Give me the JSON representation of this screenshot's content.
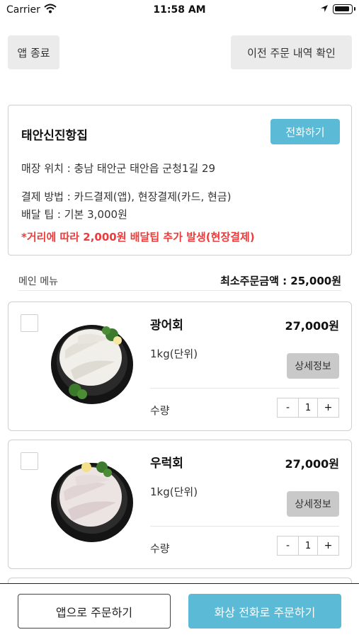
{
  "status_bar": {
    "carrier": "Carrier",
    "time": "11:58 AM",
    "icons": [
      "wifi-icon",
      "location-icon",
      "battery-icon"
    ]
  },
  "top_buttons": {
    "exit_label": "앱 종료",
    "history_label": "이전 주문 내역 확인"
  },
  "store": {
    "name": "태안신진항집",
    "call_label": "전화하기",
    "location": "매장 위치 : 충남 태안군 태안읍 군청1길 29",
    "payment": "결제 방법 : 카드결제(앱), 현장결제(카드, 현금)",
    "delivery_tip": "배달 팁 : 기본 3,000원",
    "notice": "*거리에 따라 2,000원 배달팁 추가 발생(현장결제)"
  },
  "section": {
    "title": "메인 메뉴",
    "min_order": "최소주문금액 : 25,000원"
  },
  "menu": [
    {
      "name": "광어회",
      "price": "27,000원",
      "unit": "1kg(단위)",
      "detail_label": "상세정보",
      "qty_label": "수량",
      "qty": "1",
      "minus": "-",
      "plus": "+",
      "checked": false
    },
    {
      "name": "우럭회",
      "price": "27,000원",
      "unit": "1kg(단위)",
      "detail_label": "상세정보",
      "qty_label": "수량",
      "qty": "1",
      "minus": "-",
      "plus": "+",
      "checked": false
    }
  ],
  "bottom": {
    "app_order_label": "앱으로 주문하기",
    "video_order_label": "화상 전화로 주문하기"
  },
  "colors": {
    "accent": "#5bbad5",
    "notice": "#ee3b3b",
    "button_grey": "#ebebeb",
    "detail_grey": "#c9c9c9"
  }
}
